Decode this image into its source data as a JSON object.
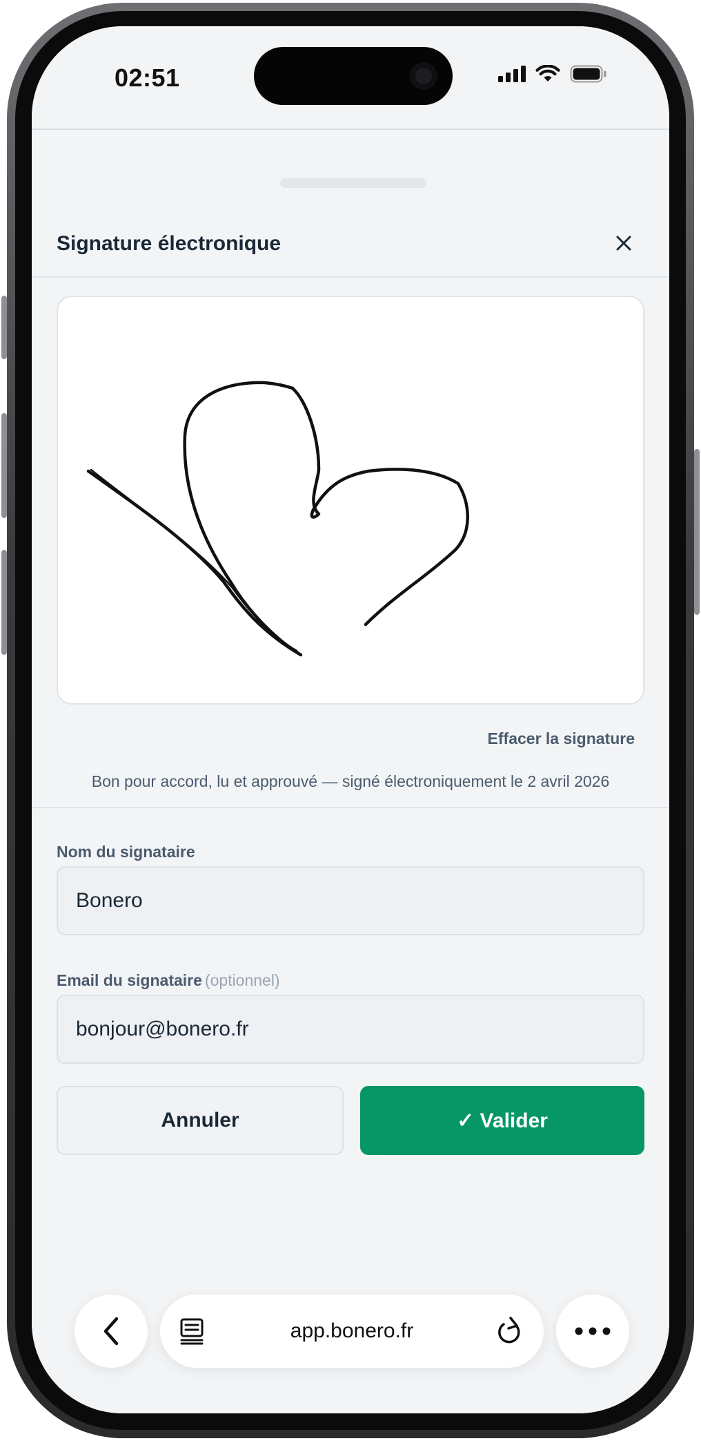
{
  "status_bar": {
    "time": "02:51"
  },
  "sheet": {
    "title": "Signature électronique",
    "close_icon": "close-icon",
    "clear_signature_label": "Effacer la signature",
    "consent_text": "Bon pour accord, lu et approuvé — signé électroniquement le 2 avril 2026"
  },
  "form": {
    "name_label": "Nom du signataire",
    "name_value": "Bonero",
    "email_label": "Email du signataire",
    "email_optional": "(optionnel)",
    "email_value": "bonjour@bonero.fr"
  },
  "actions": {
    "cancel_label": "Annuler",
    "validate_label": "✓ Valider"
  },
  "browser": {
    "url": "app.bonero.fr",
    "back_icon": "chevron-left-icon",
    "tabs_icon": "reader-icon",
    "reload_icon": "reload-icon",
    "more_icon": "more-icon"
  },
  "colors": {
    "accent": "#079665",
    "background": "#f2f4f6",
    "text": "#1b2836",
    "muted": "#4b5b6e"
  }
}
